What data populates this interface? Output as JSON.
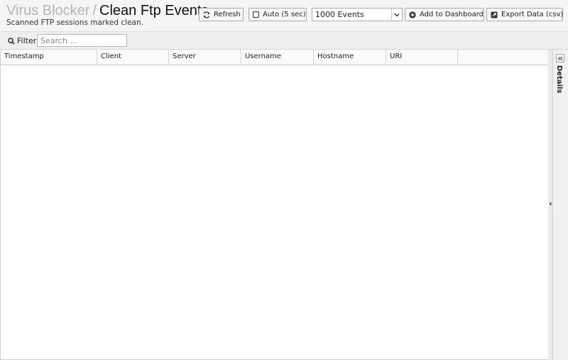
{
  "header": {
    "breadcrumb": "Virus Blocker",
    "separator": "/",
    "title": "Clean Ftp Events",
    "subtitle": "Scanned FTP sessions marked clean."
  },
  "toolbar": {
    "refresh_label": "Refresh",
    "auto_label": "Auto (5 sec)",
    "events_selected": "1000 Events",
    "add_dashboard_label": "Add to Dashboard",
    "export_label": "Export Data (csv)"
  },
  "filter": {
    "label": "Filter",
    "placeholder": "Search ..."
  },
  "grid": {
    "columns": [
      "Timestamp",
      "Client",
      "Server",
      "Username",
      "Hostname",
      "URI"
    ]
  },
  "details": {
    "label": "Details"
  },
  "icons": {
    "refresh": "refresh-icon",
    "checkbox": "checkbox-icon",
    "add": "plus-circle-icon",
    "export": "external-link-icon",
    "search": "search-icon",
    "collapse": "double-chevron-icon"
  }
}
